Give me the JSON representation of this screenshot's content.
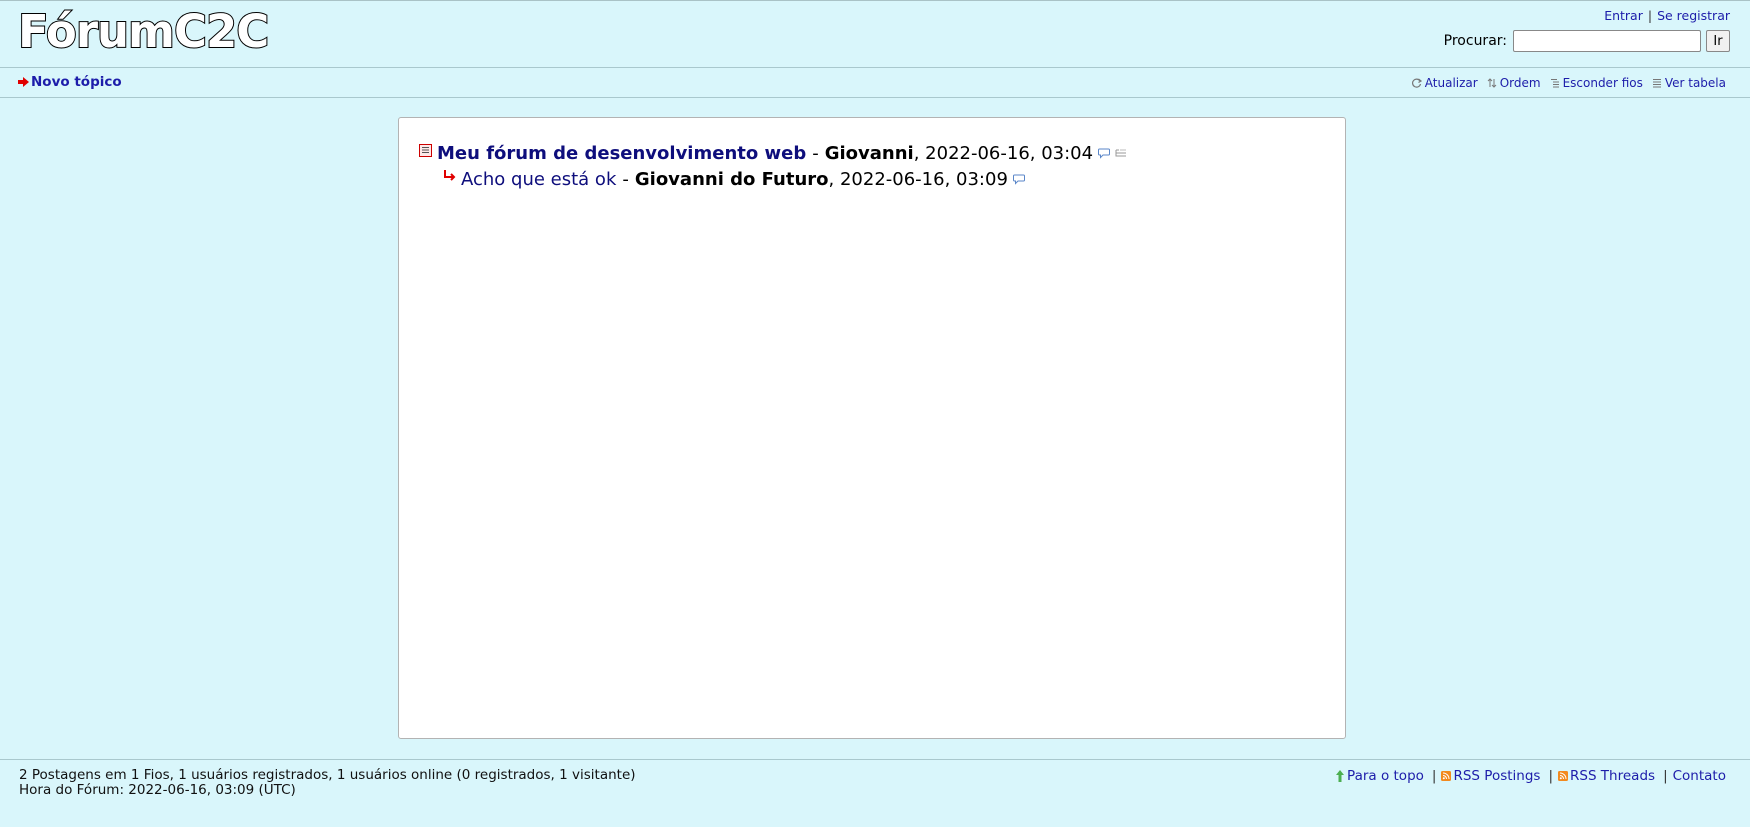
{
  "header": {
    "logo": "FórumC2C",
    "login_label": "Entrar",
    "separator": "|",
    "register_label": "Se registrar",
    "search_label": "Procurar:",
    "search_value": "",
    "search_button": "Ir"
  },
  "nav": {
    "new_topic": "Novo tópico",
    "refresh": "Atualizar",
    "order": "Ordem",
    "hide_threads": "Esconder fios",
    "table_view": "Ver tabela"
  },
  "thread": {
    "subject": "Meu fórum de desenvolvimento web",
    "dash": "-",
    "author": "Giovanni",
    "date": ", 2022-06-16, 03:04",
    "reply": {
      "subject": "Acho que está ok",
      "dash": "-",
      "author": "Giovanni do Futuro",
      "date": ", 2022-06-16, 03:09"
    }
  },
  "footer": {
    "stats_line1": "2 Postagens em 1 Fios, 1 usuários registrados, 1 usuários online (0 registrados, 1 visitante)",
    "stats_line2": "Hora do Fórum: 2022-06-16, 03:09 (UTC)",
    "to_top": "Para o topo",
    "rss_postings": "RSS Postings",
    "rss_threads": "RSS Threads",
    "contact": "Contato",
    "separator": "|"
  },
  "colors": {
    "background": "#d9f6fb",
    "link": "#1d1daa",
    "subject": "#0e0e7c",
    "accent_red": "#e00000"
  }
}
